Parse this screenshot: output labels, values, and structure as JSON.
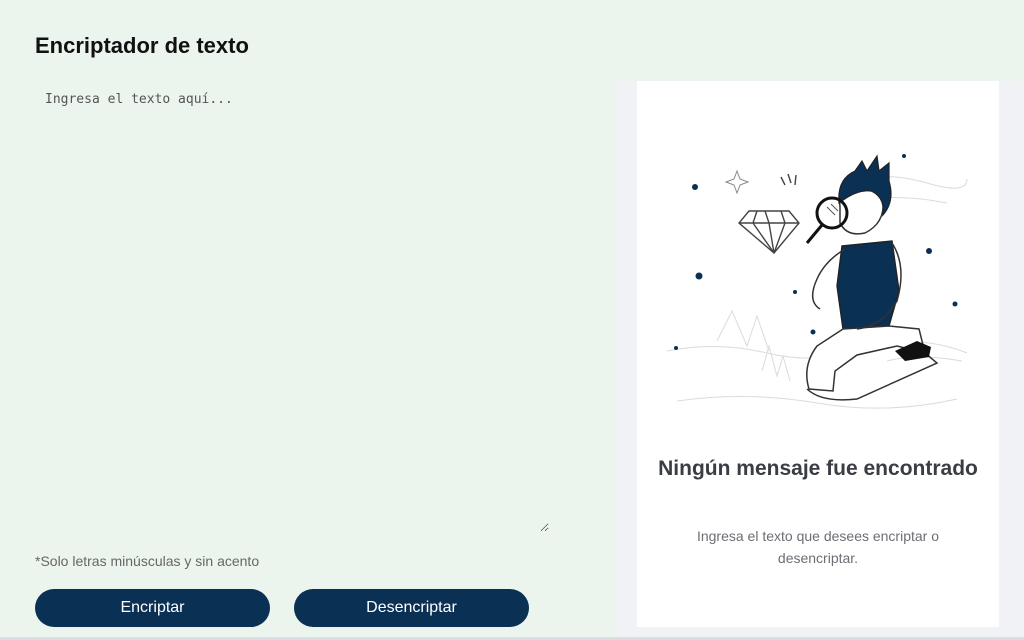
{
  "header": {
    "title": "Encriptador de texto"
  },
  "input": {
    "placeholder": "Ingresa el texto aquí..."
  },
  "hint": "*Solo letras minúsculas y sin acento",
  "buttons": {
    "encrypt": "Encriptar",
    "decrypt": "Desencriptar"
  },
  "output": {
    "title": "Ningún mensaje fue encontrado",
    "description": "Ingresa el texto que desees encriptar o desencriptar.",
    "illustration": "person-with-magnifying-glass"
  },
  "colors": {
    "accent": "#0a3054",
    "background": "#ebf5ee",
    "card": "#ffffff"
  }
}
